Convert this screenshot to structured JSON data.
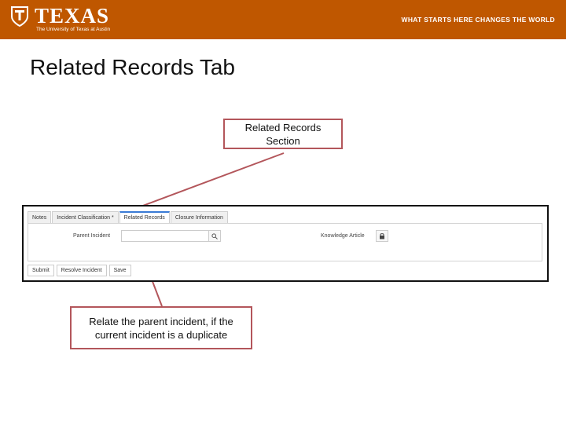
{
  "header": {
    "brand_name": "TEXAS",
    "brand_sub": "The University of Texas at Austin",
    "tagline": "WHAT STARTS HERE CHANGES THE WORLD",
    "bg_color": "#bf5700"
  },
  "slide": {
    "title": "Related Records Tab"
  },
  "callouts": {
    "top": "Related Records Section",
    "bottom": "Relate the parent incident, if the current incident is a duplicate",
    "border_color": "#b3565b"
  },
  "screenshot": {
    "tabs": [
      {
        "label": "Notes",
        "active": false
      },
      {
        "label": "Incident Classification *",
        "active": false
      },
      {
        "label": "Related Records",
        "active": true
      },
      {
        "label": "Closure Information",
        "active": false
      }
    ],
    "fields": {
      "parent_incident_label": "Parent Incident",
      "parent_incident_value": "",
      "knowledge_article_label": "Knowledge Article"
    },
    "actions": [
      "Submit",
      "Resolve Incident",
      "Save"
    ],
    "icons": {
      "search": "search-icon",
      "knowledge": "lock-icon"
    }
  }
}
